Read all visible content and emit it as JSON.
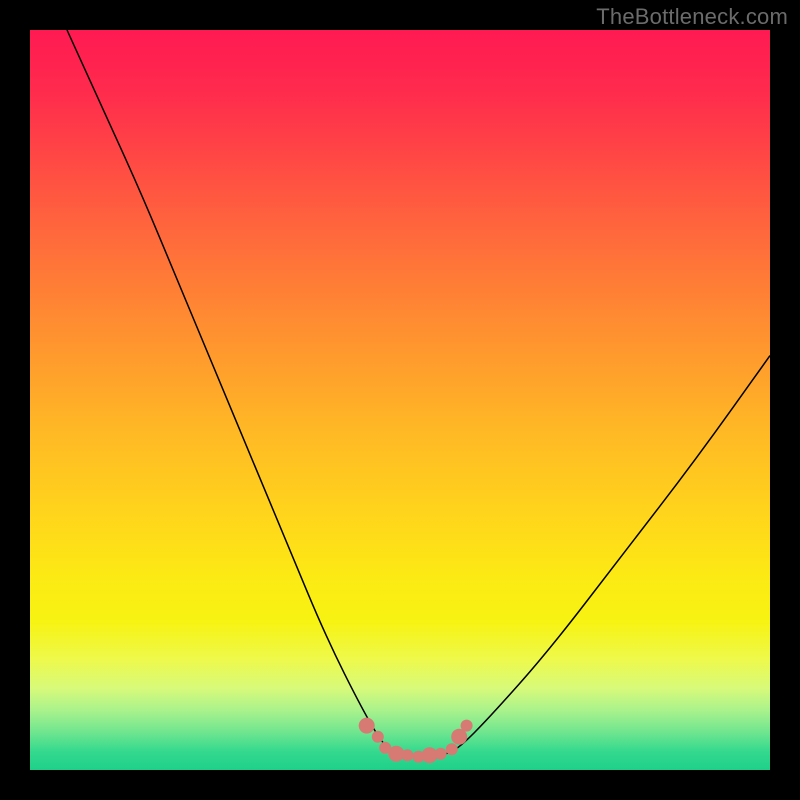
{
  "watermark": "TheBottleneck.com",
  "chart_data": {
    "type": "line",
    "title": "",
    "xlabel": "",
    "ylabel": "",
    "xlim": [
      0,
      1
    ],
    "ylim": [
      0,
      1
    ],
    "description": "V-shaped bottleneck curve over vertical rainbow gradient (red top to green bottom). Minimum region near x≈0.48–0.58 highlighted with salmon dots.",
    "series": [
      {
        "name": "curve",
        "x": [
          0.05,
          0.1,
          0.15,
          0.2,
          0.25,
          0.3,
          0.35,
          0.4,
          0.45,
          0.48,
          0.5,
          0.53,
          0.56,
          0.58,
          0.62,
          0.7,
          0.8,
          0.9,
          1.0
        ],
        "y": [
          1.0,
          0.89,
          0.78,
          0.66,
          0.54,
          0.42,
          0.3,
          0.18,
          0.08,
          0.03,
          0.02,
          0.02,
          0.02,
          0.03,
          0.07,
          0.16,
          0.29,
          0.42,
          0.56
        ]
      }
    ],
    "highlight_points": {
      "name": "optimal-region",
      "color": "#d77a74",
      "x": [
        0.455,
        0.47,
        0.48,
        0.495,
        0.51,
        0.525,
        0.54,
        0.555,
        0.57,
        0.58,
        0.59
      ],
      "y": [
        0.06,
        0.045,
        0.03,
        0.022,
        0.02,
        0.018,
        0.02,
        0.022,
        0.028,
        0.045,
        0.06
      ]
    },
    "background_gradient": {
      "direction": "top-to-bottom",
      "stops": [
        {
          "pos": 0.0,
          "color": "#ff1a52"
        },
        {
          "pos": 0.5,
          "color": "#ffb825"
        },
        {
          "pos": 0.8,
          "color": "#f7f312"
        },
        {
          "pos": 1.0,
          "color": "#1fd08a"
        }
      ]
    }
  }
}
